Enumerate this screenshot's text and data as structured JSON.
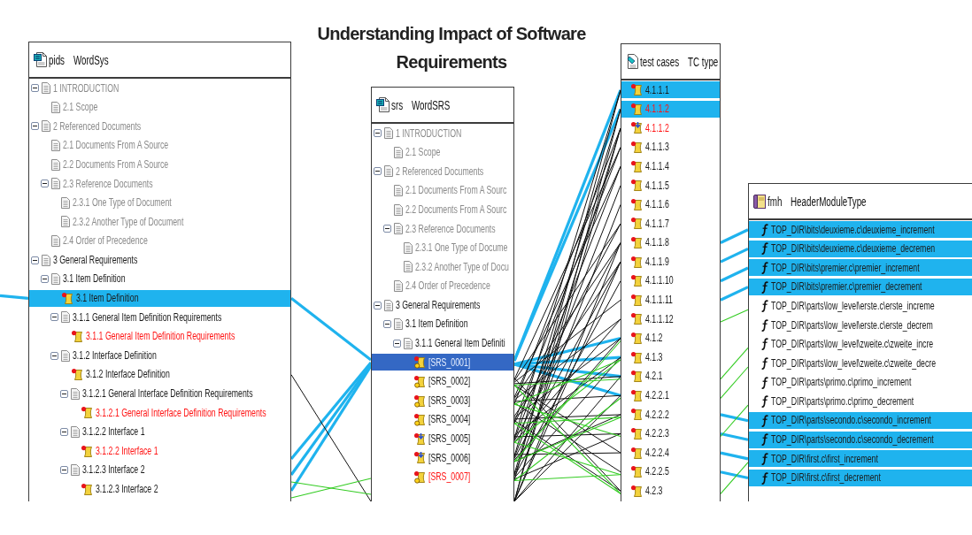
{
  "title": "Understanding Impact of Software Requirements",
  "panels": [
    {
      "kind": "document",
      "name": "pids",
      "type": "WordSys",
      "items": [
        {
          "kind": "section",
          "text": "1 INTRODUCTION",
          "expanded": true,
          "highlighted": false,
          "dimmed": true,
          "alert": false,
          "children": [
            {
              "kind": "section",
              "text": "2.1 Scope",
              "highlighted": false,
              "dimmed": true,
              "alert": false
            }
          ]
        },
        {
          "kind": "section",
          "text": "2 Referenced Documents",
          "expanded": true,
          "highlighted": false,
          "dimmed": true,
          "alert": false,
          "children": [
            {
              "kind": "section",
              "text": "2.1 Documents From A Source",
              "highlighted": false,
              "dimmed": true,
              "alert": false
            },
            {
              "kind": "section",
              "text": "2.2 Documents From A Source",
              "highlighted": false,
              "dimmed": true,
              "alert": false
            },
            {
              "kind": "section",
              "text": "2.3 Reference Documents",
              "expanded": true,
              "highlighted": false,
              "dimmed": true,
              "alert": false,
              "children": [
                {
                  "kind": "section",
                  "text": "2.3.1 One Type of Document",
                  "highlighted": false,
                  "dimmed": true,
                  "alert": false
                },
                {
                  "kind": "section",
                  "text": "2.3.2 Another Type of Document",
                  "highlighted": false,
                  "dimmed": true,
                  "alert": false
                }
              ]
            },
            {
              "kind": "section",
              "text": "2.4 Order of Precedence",
              "highlighted": false,
              "dimmed": true,
              "alert": false
            }
          ]
        },
        {
          "kind": "section",
          "text": "3 General Requirements",
          "expanded": true,
          "highlighted": false,
          "dimmed": false,
          "alert": false,
          "children": [
            {
              "kind": "section",
              "text": "3.1 Item Definition",
              "expanded": true,
              "highlighted": false,
              "dimmed": false,
              "alert": false,
              "children": [
                {
                  "kind": "requirement",
                  "text": "3.1 Item Definition",
                  "highlighted": true,
                  "dimmed": false,
                  "alert": false
                },
                {
                  "kind": "section",
                  "text": "3.1.1 General Item Definition Requirements",
                  "expanded": true,
                  "highlighted": false,
                  "dimmed": false,
                  "alert": false,
                  "children": [
                    {
                      "kind": "requirement",
                      "text": "3.1.1 General Item Definition Requirements",
                      "highlighted": false,
                      "dimmed": false,
                      "alert": true
                    }
                  ]
                },
                {
                  "kind": "section",
                  "text": "3.1.2 Interface Definition",
                  "expanded": true,
                  "highlighted": false,
                  "dimmed": false,
                  "alert": false,
                  "children": [
                    {
                      "kind": "requirement",
                      "text": "3.1.2 Interface Definition",
                      "highlighted": false,
                      "dimmed": false,
                      "alert": false
                    },
                    {
                      "kind": "section",
                      "text": "3.1.2.1 General Interface Definition Requirements",
                      "expanded": true,
                      "highlighted": false,
                      "dimmed": false,
                      "alert": false,
                      "children": [
                        {
                          "kind": "requirement",
                          "text": "3.1.2.1 General Interface Definition Requirements",
                          "highlighted": false,
                          "dimmed": false,
                          "alert": true
                        }
                      ]
                    },
                    {
                      "kind": "section",
                      "text": "3.1.2.2 Interface 1",
                      "expanded": true,
                      "highlighted": false,
                      "dimmed": false,
                      "alert": false,
                      "children": [
                        {
                          "kind": "requirement",
                          "text": "3.1.2.2 Interface 1",
                          "highlighted": false,
                          "dimmed": false,
                          "alert": true
                        }
                      ]
                    },
                    {
                      "kind": "section",
                      "text": "3.1.2.3 Interface 2",
                      "expanded": true,
                      "highlighted": false,
                      "dimmed": false,
                      "alert": false,
                      "children": [
                        {
                          "kind": "requirement",
                          "text": "3.1.2.3 Interface 2",
                          "highlighted": false,
                          "dimmed": false,
                          "alert": false
                        }
                      ]
                    }
                  ]
                }
              ]
            }
          ]
        }
      ]
    },
    {
      "kind": "document",
      "name": "srs",
      "type": "WordSRS",
      "items": [
        {
          "kind": "section",
          "text": "1 INTRODUCTION",
          "expanded": true,
          "selected": false,
          "dimmed": true,
          "alert": false,
          "children": [
            {
              "kind": "section",
              "text": "2.1 Scope",
              "selected": false,
              "dimmed": true,
              "alert": false
            }
          ]
        },
        {
          "kind": "section",
          "text": "2 Referenced Documents",
          "expanded": true,
          "selected": false,
          "dimmed": true,
          "alert": false,
          "children": [
            {
              "kind": "section",
              "text": "2.1 Documents From A Sourc",
              "selected": false,
              "dimmed": true,
              "alert": false
            },
            {
              "kind": "section",
              "text": "2.2 Documents From A Sourc",
              "selected": false,
              "dimmed": true,
              "alert": false
            },
            {
              "kind": "section",
              "text": "2.3 Reference Documents",
              "expanded": true,
              "selected": false,
              "dimmed": true,
              "alert": false,
              "children": [
                {
                  "kind": "section",
                  "text": "2.3.1 One Type of Docume",
                  "selected": false,
                  "dimmed": true,
                  "alert": false
                },
                {
                  "kind": "section",
                  "text": "2.3.2 Another Type of Docu",
                  "selected": false,
                  "dimmed": true,
                  "alert": false
                }
              ]
            },
            {
              "kind": "section",
              "text": "2.4 Order of Precedence",
              "selected": false,
              "dimmed": true,
              "alert": false
            }
          ]
        },
        {
          "kind": "section",
          "text": "3 General Requirements",
          "expanded": true,
          "selected": false,
          "dimmed": false,
          "alert": false,
          "children": [
            {
              "kind": "section",
              "text": "3.1 Item Definition",
              "expanded": true,
              "selected": false,
              "dimmed": false,
              "alert": false,
              "children": [
                {
                  "kind": "section",
                  "text": "3.1.1 General Item Definiti",
                  "expanded": true,
                  "selected": false,
                  "dimmed": false,
                  "alert": false,
                  "children": [
                    {
                      "kind": "dot-requirement",
                      "text": "[SRS_0001]",
                      "selected": true,
                      "dimmed": false,
                      "alert": false
                    },
                    {
                      "kind": "dot-requirement",
                      "text": "[SRS_0002]",
                      "selected": false,
                      "dimmed": false,
                      "alert": false
                    },
                    {
                      "kind": "dot-requirement",
                      "text": "[SRS_0003]",
                      "selected": false,
                      "dimmed": false,
                      "alert": false
                    },
                    {
                      "kind": "dot-requirement",
                      "text": "[SRS_0004]",
                      "selected": false,
                      "dimmed": false,
                      "alert": false
                    },
                    {
                      "kind": "arrow-requirement",
                      "text": "[SRS_0005]",
                      "selected": false,
                      "dimmed": false,
                      "alert": false
                    },
                    {
                      "kind": "arrow-requirement",
                      "text": "[SRS_0006]",
                      "selected": false,
                      "dimmed": false,
                      "alert": false
                    },
                    {
                      "kind": "dot-requirement",
                      "text": "[SRS_0007]",
                      "selected": false,
                      "dimmed": false,
                      "alert": true
                    }
                  ]
                }
              ]
            }
          ]
        }
      ]
    },
    {
      "kind": "test-suite",
      "name": "test cases",
      "type": "TC type",
      "items": [
        {
          "kind": "test-case",
          "text": "4.1.1.1",
          "highlighted": true,
          "alert": false
        },
        {
          "kind": "test-case",
          "text": "4.1.1.2",
          "highlighted": true,
          "alert": true
        },
        {
          "kind": "arrow-test-case",
          "text": "4.1.1.2",
          "highlighted": false,
          "alert": true
        },
        {
          "kind": "test-case",
          "text": "4.1.1.3",
          "highlighted": false,
          "alert": false
        },
        {
          "kind": "test-case",
          "text": "4.1.1.4",
          "highlighted": false,
          "alert": false
        },
        {
          "kind": "test-case",
          "text": "4.1.1.5",
          "highlighted": false,
          "alert": false
        },
        {
          "kind": "test-case",
          "text": "4.1.1.6",
          "highlighted": false,
          "alert": false
        },
        {
          "kind": "test-case",
          "text": "4.1.1.7",
          "highlighted": false,
          "alert": false
        },
        {
          "kind": "test-case",
          "text": "4.1.1.8",
          "highlighted": false,
          "alert": false
        },
        {
          "kind": "test-case",
          "text": "4.1.1.9",
          "highlighted": false,
          "alert": false
        },
        {
          "kind": "test-case",
          "text": "4.1.1.10",
          "highlighted": false,
          "alert": false
        },
        {
          "kind": "test-case",
          "text": "4.1.1.11",
          "highlighted": false,
          "alert": false
        },
        {
          "kind": "test-case",
          "text": "4.1.1.12",
          "highlighted": false,
          "alert": false
        },
        {
          "kind": "test-case",
          "text": "4.1.2",
          "highlighted": false,
          "alert": false
        },
        {
          "kind": "test-case",
          "text": "4.1.3",
          "highlighted": false,
          "alert": false
        },
        {
          "kind": "test-case",
          "text": "4.2.1",
          "highlighted": false,
          "alert": false
        },
        {
          "kind": "test-case",
          "text": "4.2.2.1",
          "highlighted": false,
          "alert": false
        },
        {
          "kind": "test-case",
          "text": "4.2.2.2",
          "highlighted": false,
          "alert": false
        },
        {
          "kind": "test-case",
          "text": "4.2.2.3",
          "highlighted": false,
          "alert": false
        },
        {
          "kind": "test-case",
          "text": "4.2.2.4",
          "highlighted": false,
          "alert": false
        },
        {
          "kind": "test-case",
          "text": "4.2.2.5",
          "highlighted": false,
          "alert": false
        },
        {
          "kind": "test-case",
          "text": "4.2.3",
          "highlighted": false,
          "alert": false
        }
      ]
    },
    {
      "kind": "module",
      "name": "fmh",
      "type": "HeaderModuleType",
      "items": [
        {
          "kind": "function",
          "text": "TOP_DIR\\bits\\deuxieme.c\\deuxieme_increment",
          "highlighted": true
        },
        {
          "kind": "function",
          "text": "TOP_DIR\\bits\\deuxieme.c\\deuxieme_decremen",
          "highlighted": true
        },
        {
          "kind": "function",
          "text": "TOP_DIR\\bits\\premier.c\\premier_increment",
          "highlighted": true
        },
        {
          "kind": "function",
          "text": "TOP_DIR\\bits\\premier.c\\premier_decrement",
          "highlighted": true
        },
        {
          "kind": "function",
          "text": "TOP_DIR\\parts\\low_level\\erste.c\\erste_increme",
          "highlighted": false
        },
        {
          "kind": "function",
          "text": "TOP_DIR\\parts\\low_level\\erste.c\\erste_decrem",
          "highlighted": false
        },
        {
          "kind": "function",
          "text": "TOP_DIR\\parts\\low_level\\zweite.c\\zweite_incre",
          "highlighted": false
        },
        {
          "kind": "function",
          "text": "TOP_DIR\\parts\\low_level\\zweite.c\\zweite_decre",
          "highlighted": false
        },
        {
          "kind": "function",
          "text": "TOP_DIR\\parts\\primo.c\\primo_increment",
          "highlighted": false
        },
        {
          "kind": "function",
          "text": "TOP_DIR\\parts\\primo.c\\primo_decrement",
          "highlighted": false
        },
        {
          "kind": "function",
          "text": "TOP_DIR\\parts\\secondo.c\\secondo_increment",
          "highlighted": true
        },
        {
          "kind": "function",
          "text": "TOP_DIR\\parts\\secondo.c\\secondo_decrement",
          "highlighted": true
        },
        {
          "kind": "function",
          "text": "TOP_DIR\\first.c\\first_increment",
          "highlighted": true
        },
        {
          "kind": "function",
          "text": "TOP_DIR\\first.c\\first_decrement",
          "highlighted": true
        }
      ]
    }
  ]
}
